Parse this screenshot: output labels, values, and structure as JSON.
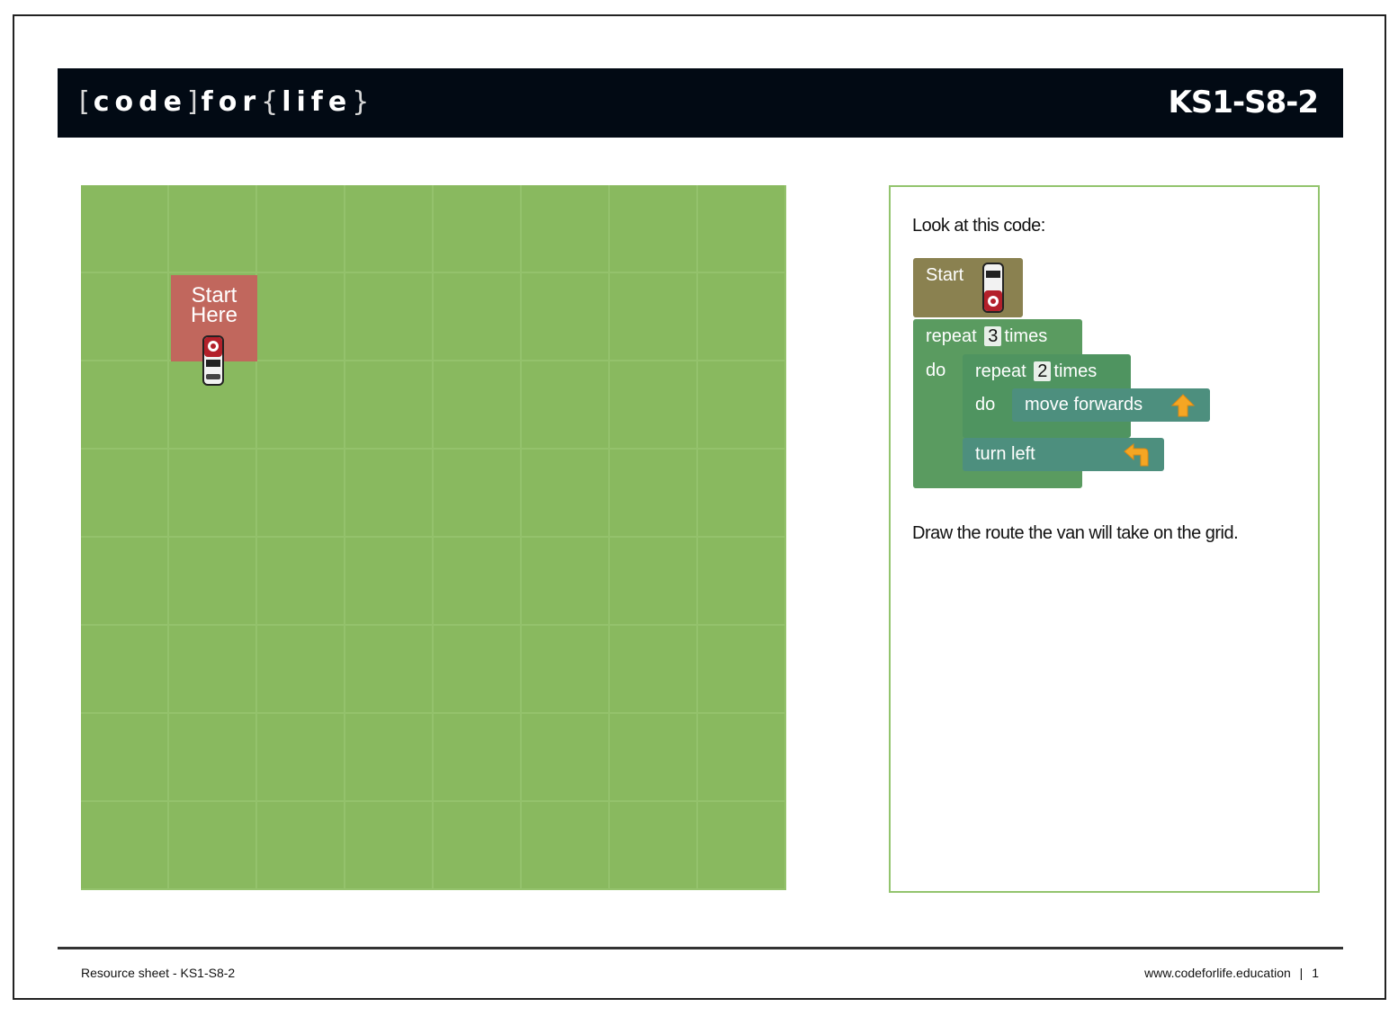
{
  "header": {
    "logo": {
      "open_bracket": "[",
      "word1": "code",
      "close_bracket": "]",
      "word2": "for",
      "open_brace": "{",
      "word3": "life",
      "close_brace": "}"
    },
    "sheet_code": "KS1-S8-2"
  },
  "grid": {
    "rows": 8,
    "columns": 8,
    "start_label_line1": "Start",
    "start_label_line2": "Here",
    "colors": {
      "grass": "#89b95f",
      "start_tile": "#c1675d"
    }
  },
  "panel": {
    "intro": "Look at this code:",
    "blocks": {
      "start": "Start",
      "repeat_outer": {
        "word": "repeat",
        "count": "3",
        "suffix": "times",
        "do": "do"
      },
      "repeat_inner": {
        "word": "repeat",
        "count": "2",
        "suffix": "times",
        "do": "do"
      },
      "move": "move forwards",
      "turn": "turn left"
    },
    "instruction": "Draw the route the van will take on the grid."
  },
  "footer": {
    "left": "Resource sheet - KS1-S8-2",
    "website": "www.codeforlife.education",
    "separator": "|",
    "page": "1"
  },
  "icons": {
    "van": "van-icon",
    "up_arrow": "arrow-up-icon",
    "turn_left_arrow": "turn-left-arrow-icon"
  }
}
